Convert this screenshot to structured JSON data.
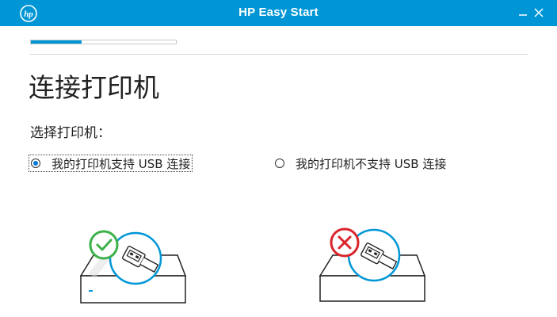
{
  "window": {
    "title": "HP Easy Start",
    "logo_text": "hp",
    "minimize_glyph": "–",
    "close_glyph": "✕"
  },
  "progress": {
    "fraction": 0.35
  },
  "page": {
    "title": "连接打印机",
    "prompt": "选择打印机："
  },
  "options": [
    {
      "label": "我的打印机支持 USB 连接",
      "selected": true,
      "icon": "check-circle-icon"
    },
    {
      "label": "我的打印机不支持 USB 连接",
      "selected": false,
      "icon": "x-circle-icon"
    }
  ],
  "colors": {
    "brand_blue": "#0096d6",
    "success_green": "#3db14a",
    "error_red": "#d9242b"
  }
}
